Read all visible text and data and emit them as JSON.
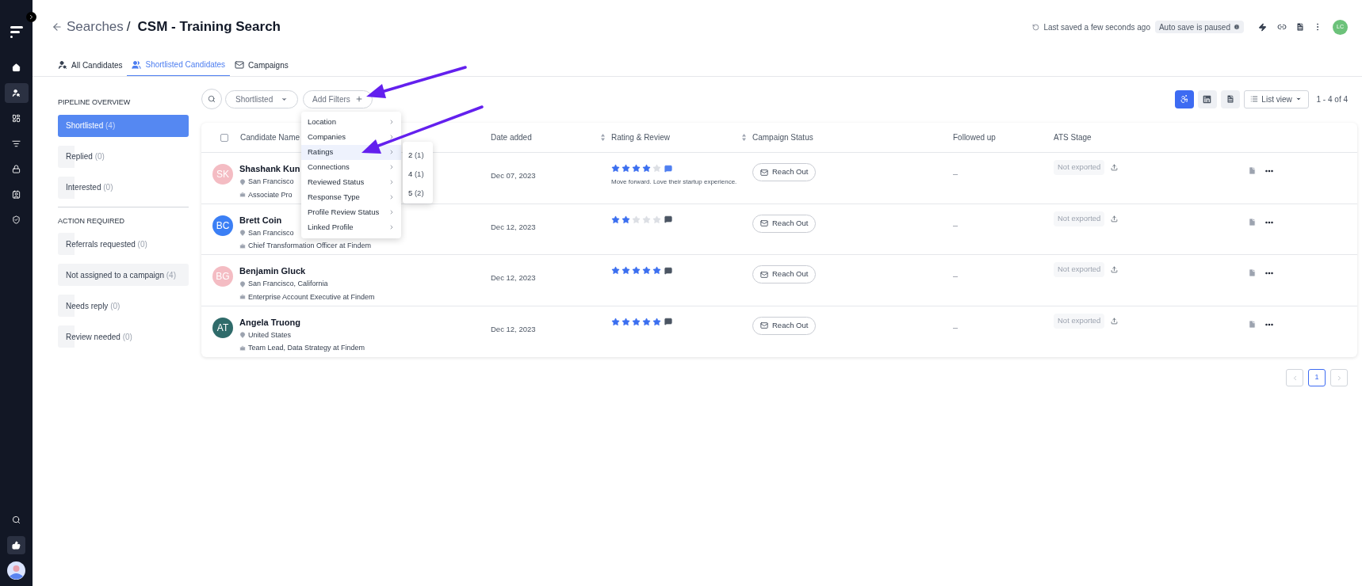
{
  "nav": {
    "top": [
      {
        "selected": false
      },
      {
        "selected": true
      },
      {
        "selected": false
      },
      {
        "selected": false
      },
      {
        "selected": false
      },
      {
        "selected": false
      },
      {
        "selected": false
      }
    ],
    "bottom": [
      {
        "selected": false
      },
      {
        "selected": true
      }
    ]
  },
  "header": {
    "back_label": "Searches",
    "separator": "/",
    "title": "CSM - Training Search",
    "last_saved": "Last saved a few seconds ago",
    "autosave_badge": "Auto save is paused",
    "avatar": "LC"
  },
  "tabs": [
    {
      "label": "All Candidates",
      "selected": false
    },
    {
      "label": "Shortlisted Candidates",
      "selected": true
    },
    {
      "label": "Campaigns",
      "selected": false
    }
  ],
  "pipeline": [
    {
      "title": "PIPELINE OVERVIEW",
      "items": [
        {
          "label": "Shortlisted",
          "count": "(4)",
          "selected": true,
          "highlighted": false
        },
        {
          "label": "Replied",
          "count": "(0)",
          "selected": false,
          "highlighted": false
        },
        {
          "label": "Interested",
          "count": "(0)",
          "selected": false,
          "highlighted": false
        }
      ]
    },
    {
      "title": "ACTION REQUIRED",
      "items": [
        {
          "label": "Referrals requested",
          "count": "(0)",
          "selected": false,
          "highlighted": false
        },
        {
          "label": "Not assigned to a campaign",
          "count": "(4)",
          "selected": false,
          "highlighted": true
        },
        {
          "label": "Needs reply",
          "count": "(0)",
          "selected": false,
          "highlighted": false
        },
        {
          "label": "Review needed",
          "count": "(0)",
          "selected": false,
          "highlighted": false
        }
      ]
    }
  ],
  "toolbar": {
    "status_filter": "Shortlisted",
    "add_filters": "Add Filters",
    "views": [
      {
        "selected": true
      },
      {
        "selected": false
      },
      {
        "selected": false
      }
    ],
    "list_view": "List view",
    "range": "1 - 4 of 4"
  },
  "filter_menu": {
    "items": [
      {
        "label": "Location",
        "selected": false
      },
      {
        "label": "Companies",
        "selected": false
      },
      {
        "label": "Ratings",
        "selected": true
      },
      {
        "label": "Connections",
        "selected": false
      },
      {
        "label": "Reviewed Status",
        "selected": false
      },
      {
        "label": "Response Type",
        "selected": false
      },
      {
        "label": "Profile Review Status",
        "selected": false
      },
      {
        "label": "Linked Profile",
        "selected": false
      }
    ],
    "submenu": [
      {
        "value": "2",
        "count": "(1)"
      },
      {
        "value": "4",
        "count": "(1)"
      },
      {
        "value": "5",
        "count": "(2)"
      }
    ]
  },
  "table": {
    "checked": false,
    "columns": [
      {
        "label": "Candidate Name",
        "sortable": false
      },
      {
        "label": "Date added",
        "sortable": true
      },
      {
        "label": "Rating & Review",
        "sortable": true
      },
      {
        "label": "Campaign Status",
        "sortable": false
      },
      {
        "label": "Followed up",
        "sortable": false
      },
      {
        "label": "ATS Stage",
        "sortable": false
      }
    ],
    "rows": [
      {
        "initials": "SK",
        "color": "#f4bcc3",
        "name": "Shashank Kun",
        "location": "San Francisco",
        "title": "Associate Pro",
        "date": "Dec 07, 2023",
        "stars": 4,
        "reviewed": true,
        "review": "Move forward. Love their startup experience.",
        "campaign": "Reach Out",
        "followed_up": "–",
        "ats": "Not exported"
      },
      {
        "initials": "BC",
        "color": "#3b7ff5",
        "name": "Brett Coin",
        "location": "San Francisco",
        "title": "Chief Transformation Officer at Findem",
        "date": "Dec 12, 2023",
        "stars": 2,
        "reviewed": false,
        "campaign": "Reach Out",
        "followed_up": "–",
        "ats": "Not exported"
      },
      {
        "initials": "BG",
        "color": "#f4bcc3",
        "name": "Benjamin Gluck",
        "location": "San Francisco, California",
        "title": "Enterprise Account Executive at Findem",
        "date": "Dec 12, 2023",
        "stars": 5,
        "reviewed": false,
        "campaign": "Reach Out",
        "followed_up": "–",
        "ats": "Not exported"
      },
      {
        "initials": "AT",
        "color": "#2f6b6a",
        "name": "Angela Truong",
        "location": "United States",
        "title": "Team Lead, Data Strategy at Findem",
        "date": "Dec 12, 2023",
        "stars": 5,
        "reviewed": false,
        "campaign": "Reach Out",
        "followed_up": "–",
        "ats": "Not exported"
      }
    ]
  },
  "pagination": {
    "pages": [
      {
        "label": "1",
        "selected": true
      }
    ]
  }
}
